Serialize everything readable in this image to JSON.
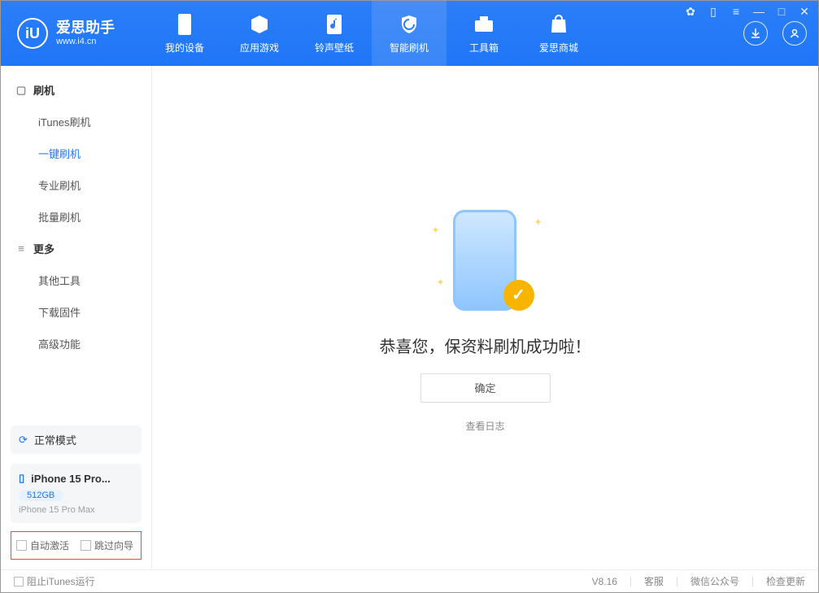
{
  "app": {
    "title": "爱思助手",
    "url": "www.i4.cn"
  },
  "nav": {
    "items": [
      {
        "label": "我的设备"
      },
      {
        "label": "应用游戏"
      },
      {
        "label": "铃声壁纸"
      },
      {
        "label": "智能刷机"
      },
      {
        "label": "工具箱"
      },
      {
        "label": "爱思商城"
      }
    ]
  },
  "sidebar": {
    "group1": {
      "title": "刷机",
      "items": [
        "iTunes刷机",
        "一键刷机",
        "专业刷机",
        "批量刷机"
      ]
    },
    "group2": {
      "title": "更多",
      "items": [
        "其他工具",
        "下载固件",
        "高级功能"
      ]
    },
    "mode": "正常模式",
    "device": {
      "name": "iPhone 15 Pro...",
      "storage": "512GB",
      "model": "iPhone 15 Pro Max"
    },
    "checks": {
      "auto_activate": "自动激活",
      "skip_guide": "跳过向导"
    }
  },
  "main": {
    "title": "恭喜您，保资料刷机成功啦！",
    "ok": "确定",
    "log": "查看日志"
  },
  "footer": {
    "prevent_itunes": "阻止iTunes运行",
    "version": "V8.16",
    "links": [
      "客服",
      "微信公众号",
      "检查更新"
    ]
  }
}
